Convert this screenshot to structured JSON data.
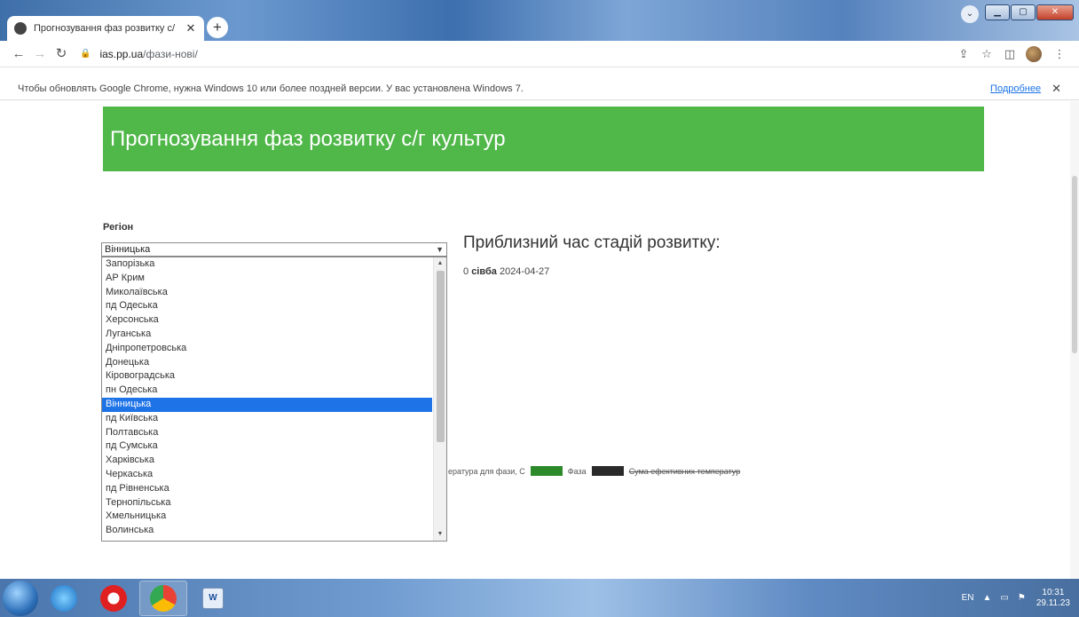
{
  "browser": {
    "tab": {
      "title": "Прогнозування фаз розвитку с/",
      "close": "✕"
    },
    "new_tab": "+",
    "url": {
      "host": "ias.pp.ua",
      "path": "/фази-нові/"
    },
    "infobar": {
      "message": "Чтобы обновлять Google Chrome, нужна Windows 10 или более поздней версии. У вас установлена Windows 7.",
      "link": "Подробнее",
      "close": "✕"
    }
  },
  "page": {
    "banner_title": "Прогнозування фаз розвитку с/г культур",
    "region_label": "Регіон",
    "selected_region": "Вінницька",
    "regions": [
      "Запорізька",
      "АР Крим",
      "Миколаївська",
      "пд Одеська",
      "Херсонська",
      "Луганська",
      "Дніпропетровська",
      "Донецька",
      "Кіровоградська",
      "пн Одеська",
      "Вінницька",
      "пд Київська",
      "Полтавська",
      "пд Сумська",
      "Харківська",
      "Черкаська",
      "пд Рівненська",
      "Тернопільська",
      "Хмельницька",
      "Волинська"
    ],
    "stages_title": "Приблизний час стадій розвитку:",
    "stage": {
      "index": "0",
      "name": "сівба",
      "date": "2024-04-27"
    },
    "legend": {
      "temp": "ература для фази, С",
      "phase": "Фаза",
      "sum": "Сума ефективних температур"
    }
  },
  "taskbar": {
    "lang": "EN",
    "time": "10:31",
    "date": "29.11.23"
  },
  "colors": {
    "banner": "#50b749",
    "selected": "#1e73e6",
    "legend_green": "#2d8a2a"
  }
}
